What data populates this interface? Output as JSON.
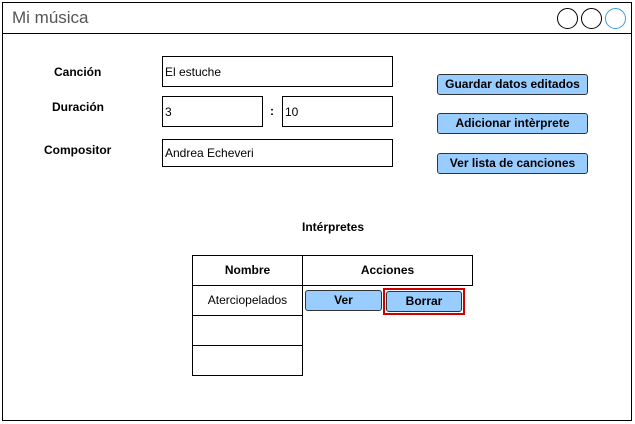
{
  "window": {
    "title": "Mi música"
  },
  "form": {
    "song_label": "Canción",
    "song_value": "El estuche",
    "duration_label": "Duración",
    "duration_minutes": "3",
    "duration_separator": ":",
    "duration_seconds": "10",
    "composer_label": "Compositor",
    "composer_value": "Andrea Echeveri"
  },
  "actions": {
    "save_label": "Guardar datos editados",
    "add_performer_label": "Adicionar intèrprete",
    "song_list_label": "Ver lista de canciones"
  },
  "performers": {
    "title": "Intérpretes",
    "columns": [
      "Nombre",
      "Acciones"
    ],
    "rows": [
      {
        "name": "Aterciopelados",
        "view_label": "Ver",
        "delete_label": "Borrar"
      }
    ]
  },
  "colors": {
    "button_fill": "#99ccff",
    "highlight": "#d00000",
    "close_button": "#3d9fd8"
  }
}
